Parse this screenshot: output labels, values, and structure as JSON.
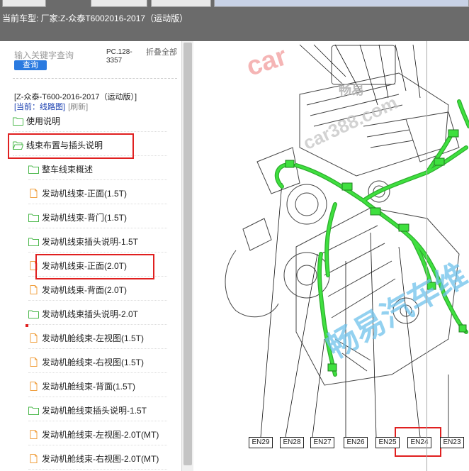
{
  "header": {
    "car_label": "当前车型:   厂家:Z-众泰T6002016-2017（运动版）"
  },
  "left_panel": {
    "search": {
      "placeholder": "输入关键字查询",
      "button_label": "查询"
    },
    "pc_code": "PC.128-3357",
    "collapse_all_label": "折叠全部",
    "model_name": "[Z-众泰-T600-2016-2017（运动版）]",
    "current_location_label": "[当前：线路图]",
    "refresh_label": "[刷新]",
    "tree_items": [
      {
        "label": "使用说明",
        "icon": "folder-icon"
      },
      {
        "label": "线束布置与插头说明",
        "icon": "folder-open-icon"
      },
      {
        "label": "整车线束概述",
        "icon": "folder-icon"
      },
      {
        "label": "发动机线束-正面(1.5T)",
        "icon": "document-icon"
      },
      {
        "label": "发动机线束-背门(1.5T)",
        "icon": "folder-icon"
      },
      {
        "label": "发动机线束插头说明-1.5T",
        "icon": "folder-icon"
      },
      {
        "label": "发动机线束-正面(2.0T)",
        "icon": "document-icon"
      },
      {
        "label": "发动机线束-背面(2.0T)",
        "icon": "document-icon"
      },
      {
        "label": "发动机线束插头说明-2.0T",
        "icon": "folder-icon"
      },
      {
        "label": "发动机舱线束-左视图(1.5T)",
        "icon": "document-icon"
      },
      {
        "label": "发动机舱线束-右视图(1.5T)",
        "icon": "document-icon"
      },
      {
        "label": "发动机舱线束-背面(1.5T)",
        "icon": "document-icon"
      },
      {
        "label": "发动机舱线束插头说明-1.5T",
        "icon": "folder-icon"
      },
      {
        "label": "发动机舱线束-左视图-2.0T(MT)",
        "icon": "document-icon"
      },
      {
        "label": "发动机舱线束-右视图-2.0T(MT)",
        "icon": "document-icon"
      }
    ]
  },
  "diagram": {
    "watermarks": [
      "car",
      "畅易",
      "car388.com",
      "畅易汽车维"
    ],
    "connector_labels": [
      "EN29",
      "EN28",
      "EN27",
      "EN26",
      "EN25",
      "EN24",
      "EN23"
    ]
  },
  "colors": {
    "header_bg": "#6b6b6b",
    "harness_green": "#3fe03f",
    "highlight_red": "#e02020",
    "search_button_blue": "#2a7ae0",
    "folder_green": "#4cb84c",
    "document_orange": "#f0a040"
  }
}
